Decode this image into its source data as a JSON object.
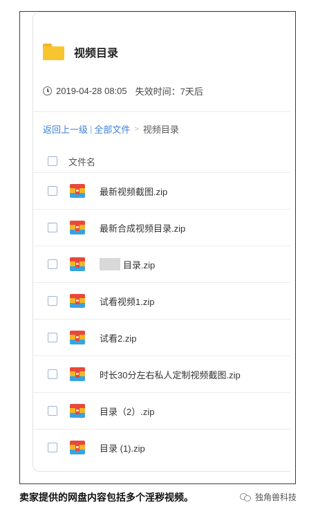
{
  "folder": {
    "title": "视频目录",
    "date": "2019-04-28 08:05",
    "expiry": "失效时间：7天后"
  },
  "breadcrumb": {
    "back": "返回上一级",
    "pipe": "|",
    "all_files": "全部文件",
    "arrow": ">",
    "current": "视频目录"
  },
  "table": {
    "column_name": "文件名"
  },
  "files": [
    {
      "name": "最新视频截图.zip"
    },
    {
      "name": "最新合成视频目录.zip"
    },
    {
      "name": "目录.zip"
    },
    {
      "name": "试看视频1.zip"
    },
    {
      "name": "试看2.zip"
    },
    {
      "name": "时长30分左右私人定制视频截图.zip"
    },
    {
      "name": "目录（2）.zip"
    },
    {
      "name": "目录 (1).zip"
    }
  ],
  "caption": "卖家提供的网盘内容包括多个淫秽视频。",
  "watermark": "独角兽科技",
  "colors": {
    "link": "#3b82d6",
    "folder": "#f8c530",
    "zip_red": "#e8483a",
    "zip_yellow": "#f3b526",
    "zip_blue": "#39a3e0"
  }
}
